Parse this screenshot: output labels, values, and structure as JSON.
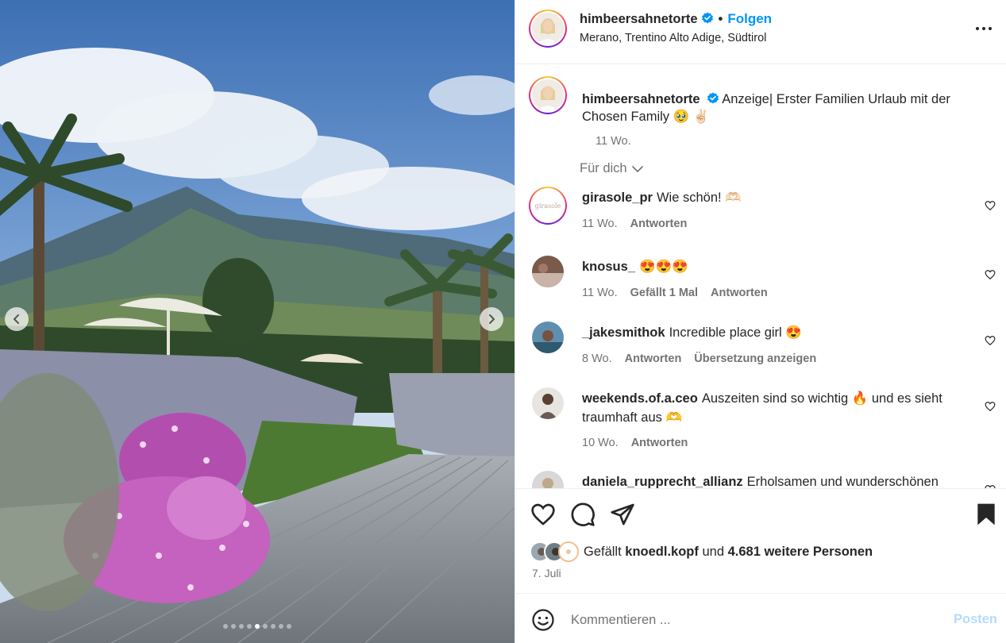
{
  "post": {
    "username": "himbeersahnetorte",
    "follow_label": "Folgen",
    "separator": "•",
    "location": "Merano, Trentino Alto Adige, Südtirol",
    "caption": "Anzeige| Erster Familien Urlaub mit der Chosen Family 🥹 ✌🏻",
    "caption_time": "11 Wo.",
    "filter_label": "Für dich",
    "carousel": {
      "total": 9,
      "active_index": 4
    }
  },
  "comments": [
    {
      "username": "girasole_pr",
      "text": "Wie schön! 🫶🏻",
      "time": "11 Wo.",
      "likes": "",
      "reply": "Antworten",
      "translate": ""
    },
    {
      "username": "knosus_",
      "text": "😍😍😍",
      "time": "11 Wo.",
      "likes": "Gefällt 1 Mal",
      "reply": "Antworten",
      "translate": ""
    },
    {
      "username": "_jakesmithok",
      "text": "Incredible place girl 😍",
      "time": "8 Wo.",
      "likes": "",
      "reply": "Antworten",
      "translate": "Übersetzung anzeigen"
    },
    {
      "username": "weekends.of.a.ceo",
      "text": "Auszeiten sind so wichtig 🔥  und es sieht traumhaft aus 🫶",
      "time": "10 Wo.",
      "likes": "",
      "reply": "Antworten",
      "translate": ""
    },
    {
      "username": "daniela_rupprecht_allianz",
      "text": "Erholsamen und wunderschönen",
      "time": "",
      "likes": "",
      "reply": "",
      "translate": ""
    }
  ],
  "likes": {
    "prefix": "Gefällt",
    "liker": "knoedl.kopf",
    "middle": "und",
    "others": "4.681 weitere Personen"
  },
  "date": "7. Juli",
  "composer": {
    "placeholder": "Kommentieren ...",
    "post_label": "Posten"
  },
  "avatars": {
    "girasole_logo_text": "girasole"
  },
  "colors": {
    "accent": "#0095f6",
    "post_disabled": "#b3dbff",
    "meta": "#737373"
  },
  "icons": [
    "more-icon",
    "verified-icon",
    "chevron-left-icon",
    "chevron-right-icon",
    "chevron-down-icon",
    "heart-icon",
    "comment-icon",
    "share-icon",
    "bookmark-icon",
    "emoji-icon"
  ]
}
